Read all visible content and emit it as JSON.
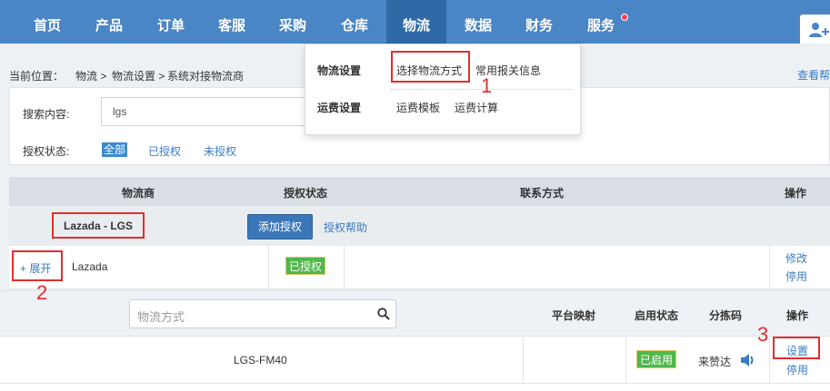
{
  "nav": {
    "items": [
      {
        "label": "首页"
      },
      {
        "label": "产品"
      },
      {
        "label": "订单"
      },
      {
        "label": "客服"
      },
      {
        "label": "采购"
      },
      {
        "label": "仓库"
      },
      {
        "label": "物流"
      },
      {
        "label": "数据"
      },
      {
        "label": "财务"
      },
      {
        "label": "服务"
      }
    ],
    "active": "物流"
  },
  "breadcrumb": {
    "prefix": "当前位置：",
    "items": [
      "物流 >",
      "物流设置 >",
      "系统对接物流商"
    ],
    "right_link": "查看帮"
  },
  "search": {
    "label": "搜索内容:",
    "value": "lgs",
    "auth_label": "授权状态:",
    "filters": [
      "全部",
      "已授权",
      "未授权"
    ]
  },
  "dropdown": {
    "logistics_settings": "物流设置",
    "select_method": "选择物流方式",
    "customs_info": "常用报关信息",
    "freight_settings": "运费设置",
    "freight_template": "运费模板",
    "freight_calc": "运费计算"
  },
  "table": {
    "headers": [
      "物流商",
      "授权状态",
      "联系方式",
      "操作"
    ],
    "group_name": "Lazada - LGS",
    "add_auth": "添加授权",
    "auth_help": "授权帮助",
    "row": {
      "expand": "+ 展开",
      "name": "Lazada",
      "status": "已授权",
      "op_edit": "修改",
      "op_disable": "停用"
    }
  },
  "sub": {
    "search_placeholder": "物流方式",
    "headers": [
      "平台映射",
      "启用状态",
      "分拣码",
      "操作"
    ],
    "row": {
      "method": "LGS-FM40",
      "enabled": "已启用",
      "sort_code": "来赞达",
      "op_set": "设置",
      "op_disable": "停用"
    }
  },
  "annotations": [
    "1",
    "2",
    "3"
  ],
  "colors": {
    "nav_bg": "#4a86c5",
    "nav_active": "#2f6aa7",
    "link": "#3a7cc2",
    "green": "#4fb84a",
    "annotation_red": "#e42d2d"
  }
}
